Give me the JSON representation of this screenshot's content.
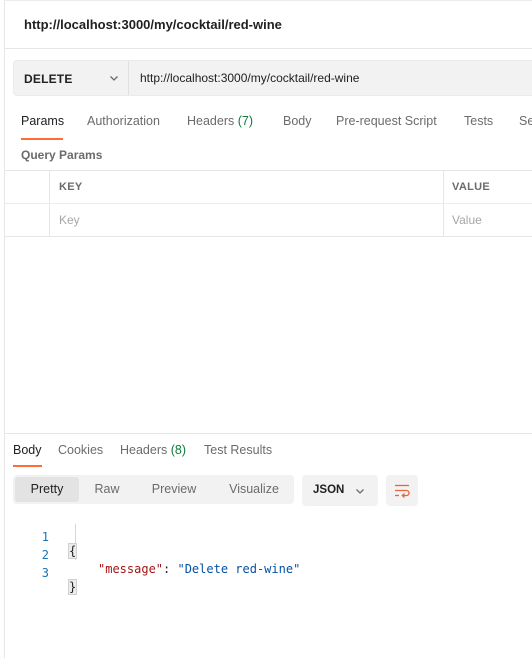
{
  "title_bar": {
    "title": "http://localhost:3000/my/cocktail/red-wine"
  },
  "request": {
    "method": "DELETE",
    "url": "http://localhost:3000/my/cocktail/red-wine"
  },
  "request_tabs": [
    {
      "label": "Params",
      "active": true
    },
    {
      "label": "Authorization"
    },
    {
      "label": "Headers ",
      "count": "(7)"
    },
    {
      "label": "Body"
    },
    {
      "label": "Pre-request Script"
    },
    {
      "label": "Tests"
    },
    {
      "label": "Se"
    }
  ],
  "query_params": {
    "heading": "Query Params",
    "columns": {
      "key": "KEY",
      "value": "VALUE"
    },
    "placeholders": {
      "key": "Key",
      "value": "Value"
    }
  },
  "response_tabs": [
    {
      "label": "Body",
      "active": true
    },
    {
      "label": "Cookies"
    },
    {
      "label": "Headers ",
      "count": "(8)"
    },
    {
      "label": "Test Results"
    }
  ],
  "view_modes": [
    "Pretty",
    "Raw",
    "Preview",
    "Visualize"
  ],
  "active_view": "Pretty",
  "format": "JSON",
  "body": {
    "line_numbers": [
      "1",
      "2",
      "3"
    ],
    "open_brace": "{",
    "key": "\"message\"",
    "colon": ": ",
    "value": "\"Delete red-wine\"",
    "close_brace": "}"
  },
  "colors": {
    "accent": "#ff6c37",
    "count": "#0f7a39",
    "json_key": "#a31515",
    "json_string": "#0451a5",
    "line_number": "#1a73b5"
  },
  "icons": {
    "method_dropdown": "chevron-down-icon",
    "format_dropdown": "chevron-down-icon",
    "wrap": "wrap-lines-icon"
  }
}
